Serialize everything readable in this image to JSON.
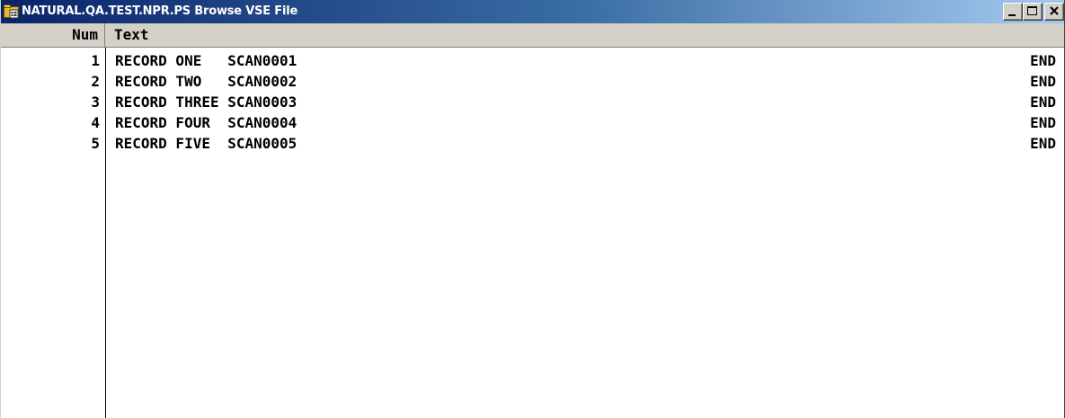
{
  "window": {
    "title": "NATURAL.QA.TEST.NPR.PS Browse VSE File",
    "title_bar_color": "#0a246a"
  },
  "header": {
    "num_label": "Num",
    "text_label": "Text"
  },
  "rows": [
    {
      "num": "1",
      "text": "RECORD ONE   SCAN0001",
      "end": "END"
    },
    {
      "num": "2",
      "text": "RECORD TWO   SCAN0002",
      "end": "END"
    },
    {
      "num": "3",
      "text": "RECORD THREE SCAN0003",
      "end": "END"
    },
    {
      "num": "4",
      "text": "RECORD FOUR  SCAN0004",
      "end": "END"
    },
    {
      "num": "5",
      "text": "RECORD FIVE  SCAN0005",
      "end": "END"
    }
  ],
  "icons": {
    "app": "folder-app-icon",
    "minimize": "minimize-icon",
    "maximize": "maximize-icon",
    "close": "close-icon"
  }
}
